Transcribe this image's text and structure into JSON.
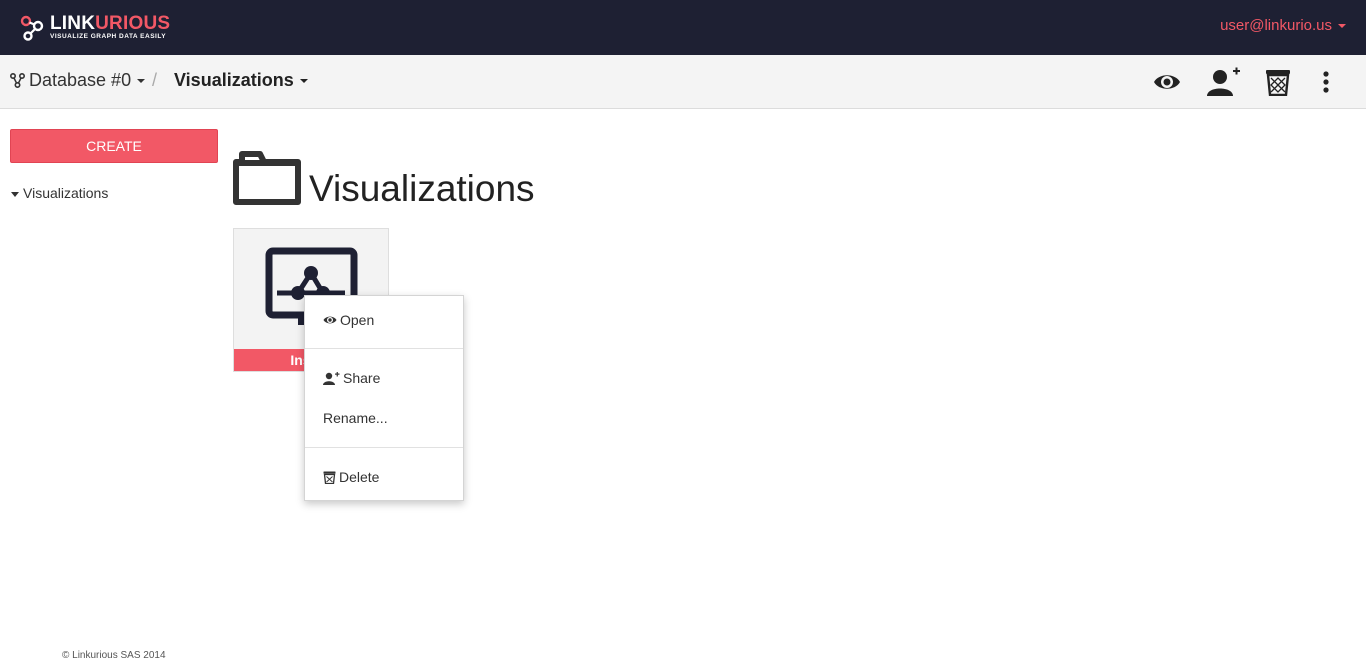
{
  "brand": {
    "name_part1": "LINK",
    "name_part2": "URIOUS",
    "tagline": "VISUALIZE GRAPH DATA EASILY",
    "accent_color": "#f25866",
    "navbar_color": "#1e2033"
  },
  "user_menu": {
    "label": "user@linkurio.us"
  },
  "breadcrumb": {
    "database": "Database #0",
    "separator": "/",
    "section": "Visualizations"
  },
  "toolbar": {
    "icons": [
      "eye-icon",
      "add-user-icon",
      "trash-icon",
      "more-vertical-icon"
    ]
  },
  "sidebar": {
    "create_label": "CREATE",
    "tree_item": "Visualizations"
  },
  "main": {
    "title": "Visualizations",
    "cards": [
      {
        "label": "Instag"
      }
    ]
  },
  "context_menu": {
    "open": "Open",
    "share": "Share",
    "rename": "Rename...",
    "delete": "Delete"
  },
  "footer": {
    "text": "© Linkurious SAS 2014"
  }
}
